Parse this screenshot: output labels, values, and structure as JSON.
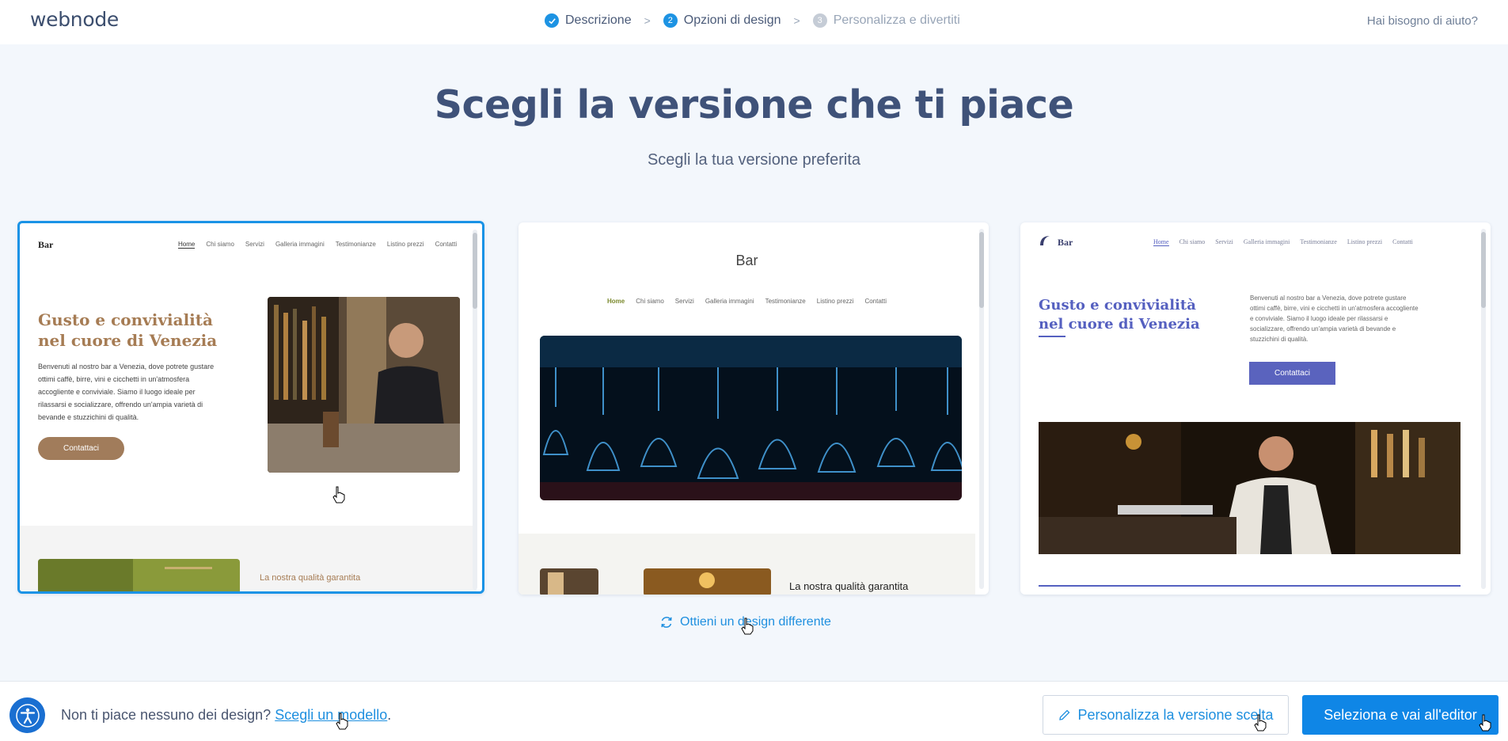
{
  "header": {
    "logo": "webnode",
    "steps": [
      {
        "num": "",
        "label": "Descrizione",
        "state": "done"
      },
      {
        "num": "2",
        "label": "Opzioni di design",
        "state": "active"
      },
      {
        "num": "3",
        "label": "Personalizza e divertiti",
        "state": "todo"
      }
    ],
    "help": "Hai bisogno di aiuto?"
  },
  "main": {
    "title": "Scegli la versione che ti piace",
    "subtitle": "Scegli la tua versione preferita",
    "other_design": "Ottieni un design differente"
  },
  "cards": [
    {
      "brand": "Bar",
      "nav": [
        "Home",
        "Chi siamo",
        "Servizi",
        "Galleria immagini",
        "Testimonianze",
        "Listino prezzi",
        "Contatti"
      ],
      "heading": "Gusto e convivialità nel cuore di Venezia",
      "body": "Benvenuti al nostro bar a Venezia, dove potrete gustare ottimi caffè, birre, vini e cicchetti in un'atmosfera accogliente e conviviale. Siamo il luogo ideale per rilassarsi e socializzare, offrendo un'ampia varietà di bevande e stuzzichini di qualità.",
      "button": "Contattaci",
      "quality": "La nostra qualità garantita"
    },
    {
      "brand": "Bar",
      "nav": [
        "Home",
        "Chi siamo",
        "Servizi",
        "Galleria immagini",
        "Testimonianze",
        "Listino prezzi",
        "Contatti"
      ],
      "quality": "La nostra qualità garantita"
    },
    {
      "brand": "Bar",
      "nav": [
        "Home",
        "Chi siamo",
        "Servizi",
        "Galleria immagini",
        "Testimonianze",
        "Listino prezzi",
        "Contatti"
      ],
      "heading": "Gusto e convivialità nel cuore di Venezia",
      "body": "Benvenuti al nostro bar a Venezia, dove potrete gustare ottimi caffè, birre, vini e cicchetti in un'atmosfera accogliente e conviviale. Siamo il luogo ideale per rilassarsi e socializzare, offrendo un'ampia varietà di bevande e stuzzichini di qualità.",
      "button": "Contattaci"
    }
  ],
  "footer": {
    "question": "Non ti piace nessuno dei design?",
    "link": "Scegli un modello",
    "link_suffix": ".",
    "customize": "Personalizza la versione scelta",
    "select": "Seleziona e vai all'editor"
  },
  "colors": {
    "accent": "#1a93e6",
    "title": "#3f5279",
    "card1_accent": "#a67c54",
    "card3_accent": "#5560c0"
  }
}
